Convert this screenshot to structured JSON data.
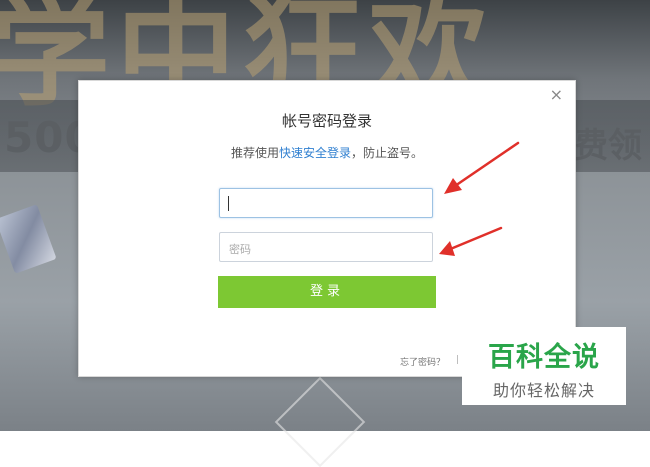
{
  "background": {
    "promo_left": "500",
    "promo_right": "费领"
  },
  "dialog": {
    "close_symbol": "×",
    "title": "帐号密码登录",
    "subtitle_prefix": "推荐使用",
    "subtitle_link": "快速安全登录",
    "subtitle_suffix": "，防止盗号。",
    "username": {
      "value": "",
      "placeholder": ""
    },
    "password": {
      "value": "",
      "placeholder": "密码"
    },
    "login_label": "登录",
    "forgot_label": "忘了密码？",
    "separator": "|"
  },
  "watermark": {
    "title": "百科全说",
    "subtitle": "助你轻松解决"
  },
  "colors": {
    "accent_green": "#7dc833",
    "link_blue": "#2f7fd0",
    "arrow_red": "#e0302a",
    "watermark_green": "#2aa54a"
  },
  "icons": [
    "close-icon",
    "red-arrow-icon"
  ]
}
